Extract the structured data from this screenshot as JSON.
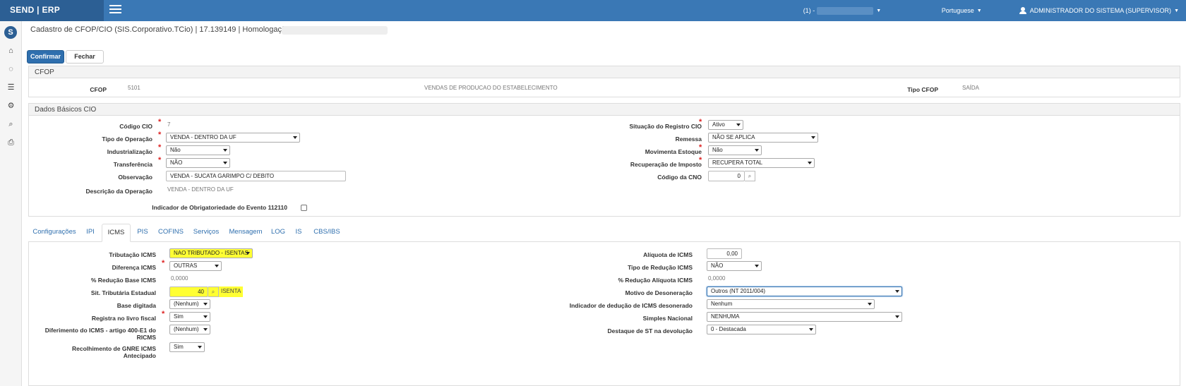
{
  "topbar": {
    "brand": "SEND | ERP",
    "account_label": "(1) -",
    "language": "Portuguese",
    "user": "ADMINISTRADOR DO SISTEMA (SUPERVISOR)"
  },
  "page": {
    "title": "Cadastro de CFOP/CIO (SIS.Corporativo.TCio) | 17.139149 | Homologação |"
  },
  "actions": {
    "confirm": "Confirmar",
    "close": "Fechar"
  },
  "cfop": {
    "header": "CFOP",
    "label": "CFOP",
    "code": "5101",
    "description": "VENDAS DE PRODUCAO DO ESTABELECIMENTO",
    "type_label": "Tipo CFOP",
    "type_value": "SAÍDA"
  },
  "basic": {
    "header": "Dados Básicos CIO",
    "codigo_cio_label": "Código CIO",
    "codigo_cio": "7",
    "tipo_operacao_label": "Tipo de Operação",
    "tipo_operacao": "VENDA - DENTRO DA UF",
    "industrializacao_label": "Industrialização",
    "industrializacao": "Não",
    "transferencia_label": "Transferência",
    "transferencia": "NÃO",
    "observacao_label": "Observação",
    "observacao": "VENDA - SUCATA GARIMPO C/ DEBITO",
    "descricao_label": "Descrição da Operação",
    "descricao": "VENDA - DENTRO DA UF",
    "indicador_label": "Indicador de Obrigatoriedade do Evento 112110",
    "situacao_label": "Situação do Registro CIO",
    "situacao": "Ativo",
    "remessa_label": "Remessa",
    "remessa": "NÃO SE APLICA",
    "movimenta_label": "Movimenta Estoque",
    "movimenta": "Não",
    "recuperacao_label": "Recuperação de Imposto",
    "recuperacao": "RECUPERA TOTAL",
    "cno_label": "Código da CNO",
    "cno": "0"
  },
  "tabs": [
    "Configurações",
    "IPI",
    "ICMS",
    "PIS",
    "COFINS",
    "Serviços",
    "Mensagem",
    "LOG",
    "IS",
    "CBS/IBS"
  ],
  "icms": {
    "tributacao_label": "Tributação ICMS",
    "tributacao": "NAO TRIBUTADO - ISENTAS",
    "diferenca_label": "Diferença ICMS",
    "diferenca": "OUTRAS",
    "reducao_base_label": "% Redução Base ICMS",
    "reducao_base": "0,0000",
    "sit_trib_label": "Sit. Tributária Estadual",
    "sit_trib": "40",
    "sit_trib_desc": "ISENTA",
    "base_digitada_label": "Base digitada",
    "base_digitada": "(Nenhum)",
    "registra_label": "Registra no livro fiscal",
    "registra": "Sim",
    "diferimento_label": "Diferimento do ICMS - artigo 400-E1 do RICMS",
    "diferimento": "(Nenhum)",
    "gnre_label": "Recolhimento de GNRE ICMS Antecipado",
    "gnre": "Sim",
    "aliquota_label": "Alíquota de ICMS",
    "aliquota": "0,00",
    "tipo_reducao_label": "Tipo de Redução ICMS",
    "tipo_reducao": "NÃO",
    "reducao_aliquota_label": "% Redução Alíquota ICMS",
    "reducao_aliquota": "0,0000",
    "motivo_label": "Motivo de Desoneração",
    "motivo": "Outros (NT 2011/004)",
    "indicador_deducao_label": "Indicador de dedução de ICMS desonerado",
    "indicador_deducao": "Nenhum",
    "simples_label": "Simples Nacional",
    "simples": "NENHUMA",
    "destaque_label": "Destaque de ST na devolução",
    "destaque": "0 - Destacada"
  }
}
